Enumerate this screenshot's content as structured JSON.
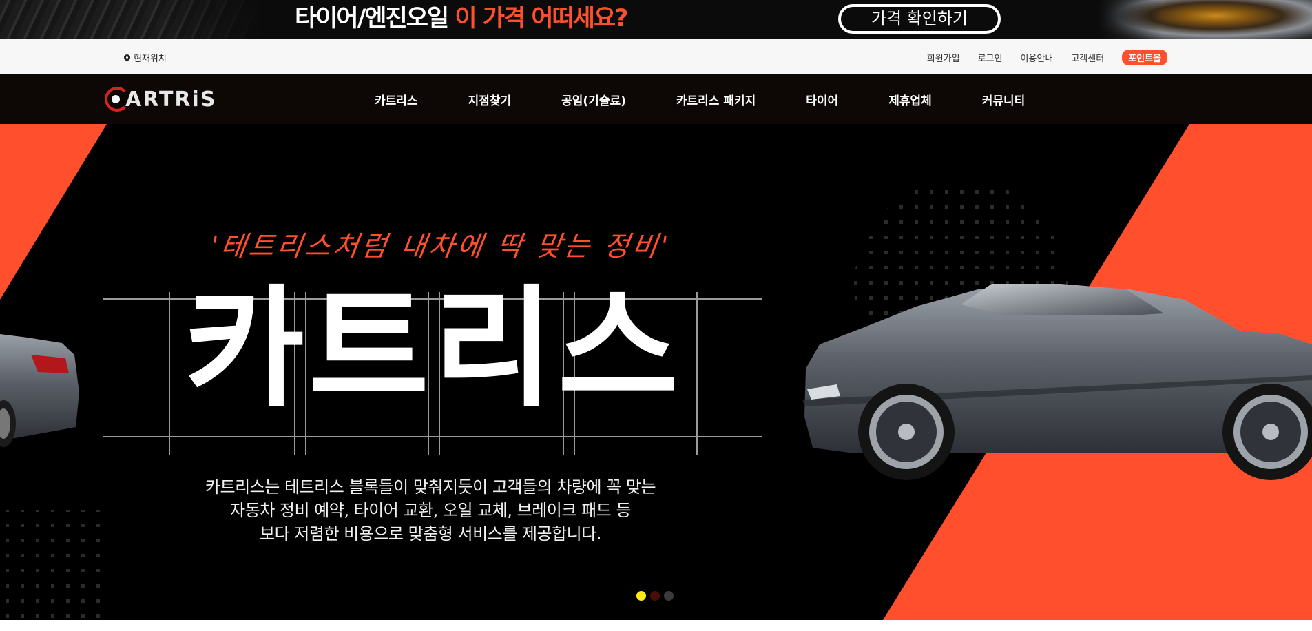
{
  "promo": {
    "text_white": "타이어/엔진오일",
    "text_orange": "이 가격 어떠세요?",
    "button_label": "가격 확인하기"
  },
  "utility": {
    "location_label": "현재위치",
    "links": [
      "회원가입",
      "로그인",
      "이용안내",
      "고객센터"
    ],
    "point_mall_label": "포인트몰"
  },
  "header": {
    "logo_text": "ARTRiS",
    "nav": [
      "카트리스",
      "지점찾기",
      "공임(기술료)",
      "카트리스 패키지",
      "타이어",
      "제휴업체",
      "커뮤니티"
    ]
  },
  "hero": {
    "slogan": "'테트리스처럼 내차에 딱 맞는 정비'",
    "title": "카트리스",
    "description": [
      "카트리스는 테트리스 블록들이 맞춰지듯이 고객들의 차량에 꼭 맞는",
      "자동차 정비 예약, 타이어 교환, 오일 교체, 브레이크 패드 등",
      "보다 저렴한 비용으로  맞춤형 서비스를 제공합니다."
    ],
    "slide_count": 3,
    "active_slide": 1
  },
  "colors": {
    "accent": "#ff4f2c",
    "nav_bg": "#0d0706",
    "indicator_active": "#ffe81a"
  }
}
